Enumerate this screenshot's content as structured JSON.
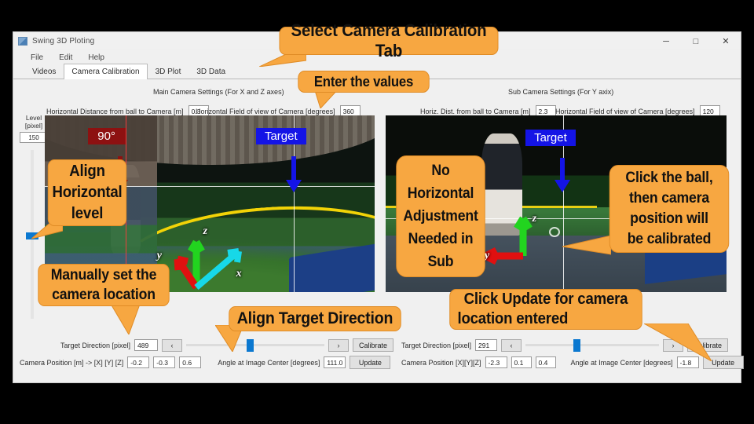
{
  "window": {
    "title": "Swing 3D Ploting",
    "icon": "app-icon",
    "buttons": {
      "minimize": "─",
      "maximize": "□",
      "close": "✕"
    },
    "menus": [
      "File",
      "Edit",
      "Help"
    ],
    "tabs": [
      {
        "label": "Videos",
        "active": false
      },
      {
        "label": "Camera Calibration",
        "active": true
      },
      {
        "label": "3D Plot",
        "active": false
      },
      {
        "label": "3D Data",
        "active": false
      }
    ]
  },
  "main_camera": {
    "section_title": "Main Camera Settings (For X and Z axes)",
    "distance_label": "Horizontal Distance from ball to Camera [m]",
    "distance_value": "0.3",
    "fov_label": "Horizontal Field of view of Camera [degrees]",
    "fov_value": "360",
    "target_direction_label": "Target Direction [pixel]",
    "target_direction_value": "489",
    "camera_position_label": "Camera Position [m]  ->  [X] [Y] [Z]",
    "camera_position": [
      "-0.2",
      "-0.3",
      "0.6"
    ],
    "angle_label": "Angle at Image Center [degrees]",
    "angle_value": "111.0",
    "prev_button": "‹",
    "next_button": "›",
    "calibrate_button": "Calibrate",
    "update_button": "Update"
  },
  "sub_camera": {
    "section_title": "Sub Camera Settings (For Y axix)",
    "distance_label": "Horiz. Dist. from ball to Camera [m]",
    "distance_value": "2.3",
    "fov_label": "Horizontal Field of view of Camera [degrees]",
    "fov_value": "120",
    "target_direction_label": "Target Direction [pixel]",
    "target_direction_value": "291",
    "camera_position_label": "Camera Position [X][Y][Z]",
    "camera_position": [
      "-2.3",
      "0.1",
      "0.4"
    ],
    "angle_label": "Angle at Image Center [degrees]",
    "angle_value": "-1.8",
    "prev_button": "‹",
    "next_button": "›",
    "calibrate_button": "Calibrate",
    "update_button": "Update"
  },
  "level_control": {
    "label_line1": "Level",
    "label_line2": "[pixel]",
    "value": "150"
  },
  "video_overlays": {
    "main_angle_tag": "90°",
    "main_target_tag": "Target",
    "sub_target_tag": "Target",
    "main_axes": {
      "x": "x",
      "y": "y",
      "z": "z"
    },
    "sub_axes": {
      "y": "y",
      "z": "z"
    }
  },
  "callouts": {
    "select_tab": "Select Camera Calibration Tab",
    "enter_values": "Enter the values",
    "align_horizontal": [
      "Align",
      "Horizontal",
      "level"
    ],
    "manual_camera": [
      "Manually set the",
      "camera location"
    ],
    "no_adjustment": [
      "No",
      "Horizontal",
      "Adjustment",
      "Needed in",
      "Sub"
    ],
    "click_ball": [
      "Click the ball,",
      "then camera",
      "position will",
      "be calibrated"
    ],
    "align_target": "Align Target Direction",
    "click_update": [
      "Click Update for camera",
      "location entered"
    ]
  },
  "colors": {
    "callout_fill": "#f7a741",
    "accent_blue": "#0b78d0",
    "tag_red": "#8d1111",
    "tag_blue": "#1414e6"
  }
}
